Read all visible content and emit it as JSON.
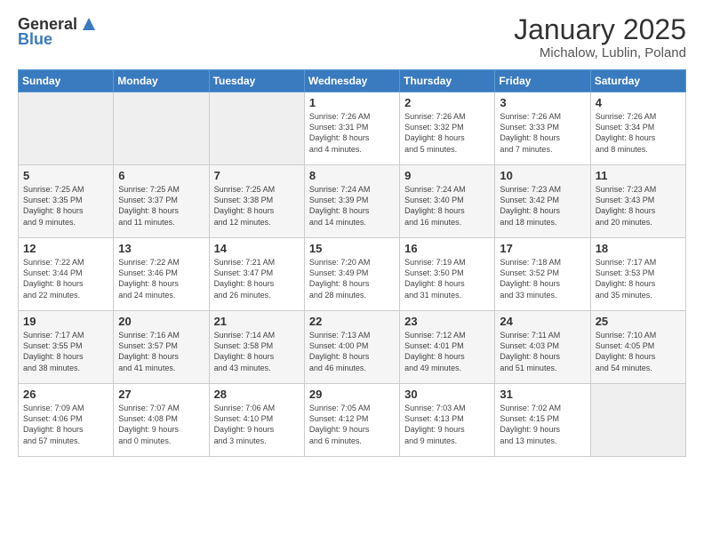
{
  "header": {
    "logo_line1": "General",
    "logo_line2": "Blue",
    "title": "January 2025",
    "subtitle": "Michalow, Lublin, Poland"
  },
  "days_of_week": [
    "Sunday",
    "Monday",
    "Tuesday",
    "Wednesday",
    "Thursday",
    "Friday",
    "Saturday"
  ],
  "weeks": [
    [
      {
        "day": "",
        "info": ""
      },
      {
        "day": "",
        "info": ""
      },
      {
        "day": "",
        "info": ""
      },
      {
        "day": "1",
        "info": "Sunrise: 7:26 AM\nSunset: 3:31 PM\nDaylight: 8 hours\nand 4 minutes."
      },
      {
        "day": "2",
        "info": "Sunrise: 7:26 AM\nSunset: 3:32 PM\nDaylight: 8 hours\nand 5 minutes."
      },
      {
        "day": "3",
        "info": "Sunrise: 7:26 AM\nSunset: 3:33 PM\nDaylight: 8 hours\nand 7 minutes."
      },
      {
        "day": "4",
        "info": "Sunrise: 7:26 AM\nSunset: 3:34 PM\nDaylight: 8 hours\nand 8 minutes."
      }
    ],
    [
      {
        "day": "5",
        "info": "Sunrise: 7:25 AM\nSunset: 3:35 PM\nDaylight: 8 hours\nand 9 minutes."
      },
      {
        "day": "6",
        "info": "Sunrise: 7:25 AM\nSunset: 3:37 PM\nDaylight: 8 hours\nand 11 minutes."
      },
      {
        "day": "7",
        "info": "Sunrise: 7:25 AM\nSunset: 3:38 PM\nDaylight: 8 hours\nand 12 minutes."
      },
      {
        "day": "8",
        "info": "Sunrise: 7:24 AM\nSunset: 3:39 PM\nDaylight: 8 hours\nand 14 minutes."
      },
      {
        "day": "9",
        "info": "Sunrise: 7:24 AM\nSunset: 3:40 PM\nDaylight: 8 hours\nand 16 minutes."
      },
      {
        "day": "10",
        "info": "Sunrise: 7:23 AM\nSunset: 3:42 PM\nDaylight: 8 hours\nand 18 minutes."
      },
      {
        "day": "11",
        "info": "Sunrise: 7:23 AM\nSunset: 3:43 PM\nDaylight: 8 hours\nand 20 minutes."
      }
    ],
    [
      {
        "day": "12",
        "info": "Sunrise: 7:22 AM\nSunset: 3:44 PM\nDaylight: 8 hours\nand 22 minutes."
      },
      {
        "day": "13",
        "info": "Sunrise: 7:22 AM\nSunset: 3:46 PM\nDaylight: 8 hours\nand 24 minutes."
      },
      {
        "day": "14",
        "info": "Sunrise: 7:21 AM\nSunset: 3:47 PM\nDaylight: 8 hours\nand 26 minutes."
      },
      {
        "day": "15",
        "info": "Sunrise: 7:20 AM\nSunset: 3:49 PM\nDaylight: 8 hours\nand 28 minutes."
      },
      {
        "day": "16",
        "info": "Sunrise: 7:19 AM\nSunset: 3:50 PM\nDaylight: 8 hours\nand 31 minutes."
      },
      {
        "day": "17",
        "info": "Sunrise: 7:18 AM\nSunset: 3:52 PM\nDaylight: 8 hours\nand 33 minutes."
      },
      {
        "day": "18",
        "info": "Sunrise: 7:17 AM\nSunset: 3:53 PM\nDaylight: 8 hours\nand 35 minutes."
      }
    ],
    [
      {
        "day": "19",
        "info": "Sunrise: 7:17 AM\nSunset: 3:55 PM\nDaylight: 8 hours\nand 38 minutes."
      },
      {
        "day": "20",
        "info": "Sunrise: 7:16 AM\nSunset: 3:57 PM\nDaylight: 8 hours\nand 41 minutes."
      },
      {
        "day": "21",
        "info": "Sunrise: 7:14 AM\nSunset: 3:58 PM\nDaylight: 8 hours\nand 43 minutes."
      },
      {
        "day": "22",
        "info": "Sunrise: 7:13 AM\nSunset: 4:00 PM\nDaylight: 8 hours\nand 46 minutes."
      },
      {
        "day": "23",
        "info": "Sunrise: 7:12 AM\nSunset: 4:01 PM\nDaylight: 8 hours\nand 49 minutes."
      },
      {
        "day": "24",
        "info": "Sunrise: 7:11 AM\nSunset: 4:03 PM\nDaylight: 8 hours\nand 51 minutes."
      },
      {
        "day": "25",
        "info": "Sunrise: 7:10 AM\nSunset: 4:05 PM\nDaylight: 8 hours\nand 54 minutes."
      }
    ],
    [
      {
        "day": "26",
        "info": "Sunrise: 7:09 AM\nSunset: 4:06 PM\nDaylight: 8 hours\nand 57 minutes."
      },
      {
        "day": "27",
        "info": "Sunrise: 7:07 AM\nSunset: 4:08 PM\nDaylight: 9 hours\nand 0 minutes."
      },
      {
        "day": "28",
        "info": "Sunrise: 7:06 AM\nSunset: 4:10 PM\nDaylight: 9 hours\nand 3 minutes."
      },
      {
        "day": "29",
        "info": "Sunrise: 7:05 AM\nSunset: 4:12 PM\nDaylight: 9 hours\nand 6 minutes."
      },
      {
        "day": "30",
        "info": "Sunrise: 7:03 AM\nSunset: 4:13 PM\nDaylight: 9 hours\nand 9 minutes."
      },
      {
        "day": "31",
        "info": "Sunrise: 7:02 AM\nSunset: 4:15 PM\nDaylight: 9 hours\nand 13 minutes."
      },
      {
        "day": "",
        "info": ""
      }
    ]
  ]
}
